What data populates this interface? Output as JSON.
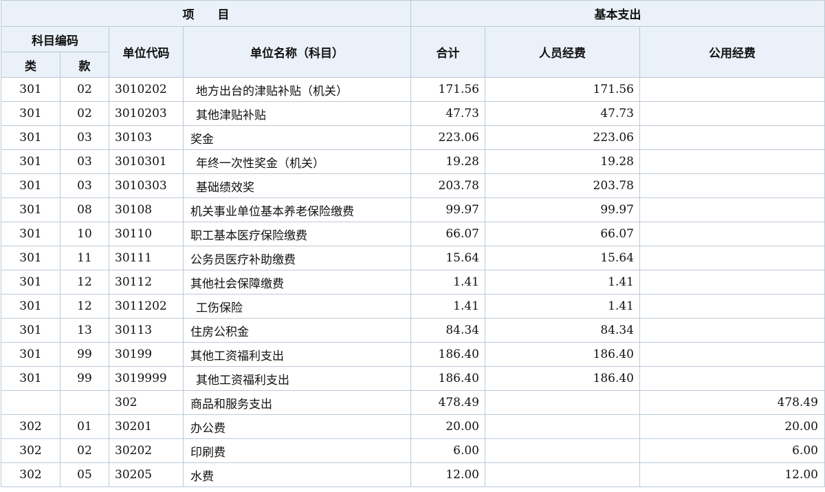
{
  "header": {
    "project": "项　　目",
    "basic_expenditure": "基本支出",
    "subject_code": "科目编码",
    "unit_code": "单位代码",
    "unit_name": "单位名称（科目）",
    "total": "合计",
    "personnel": "人员经费",
    "public": "公用经费",
    "class": "类",
    "section": "款"
  },
  "rows": [
    {
      "cls": "301",
      "kuan": "02",
      "code": "3010202",
      "name": "地方出台的津贴补贴（机关）",
      "indent": true,
      "total": "171.56",
      "personnel": "171.56",
      "public": ""
    },
    {
      "cls": "301",
      "kuan": "02",
      "code": "3010203",
      "name": "其他津贴补贴",
      "indent": true,
      "total": "47.73",
      "personnel": "47.73",
      "public": ""
    },
    {
      "cls": "301",
      "kuan": "03",
      "code": "30103",
      "name": "奖金",
      "indent": false,
      "total": "223.06",
      "personnel": "223.06",
      "public": ""
    },
    {
      "cls": "301",
      "kuan": "03",
      "code": "3010301",
      "name": "年终一次性奖金（机关）",
      "indent": true,
      "total": "19.28",
      "personnel": "19.28",
      "public": ""
    },
    {
      "cls": "301",
      "kuan": "03",
      "code": "3010303",
      "name": "基础绩效奖",
      "indent": true,
      "total": "203.78",
      "personnel": "203.78",
      "public": ""
    },
    {
      "cls": "301",
      "kuan": "08",
      "code": "30108",
      "name": "机关事业单位基本养老保险缴费",
      "indent": false,
      "total": "99.97",
      "personnel": "99.97",
      "public": ""
    },
    {
      "cls": "301",
      "kuan": "10",
      "code": "30110",
      "name": "职工基本医疗保险缴费",
      "indent": false,
      "total": "66.07",
      "personnel": "66.07",
      "public": ""
    },
    {
      "cls": "301",
      "kuan": "11",
      "code": "30111",
      "name": "公务员医疗补助缴费",
      "indent": false,
      "total": "15.64",
      "personnel": "15.64",
      "public": ""
    },
    {
      "cls": "301",
      "kuan": "12",
      "code": "30112",
      "name": "其他社会保障缴费",
      "indent": false,
      "total": "1.41",
      "personnel": "1.41",
      "public": ""
    },
    {
      "cls": "301",
      "kuan": "12",
      "code": "3011202",
      "name": "工伤保险",
      "indent": true,
      "total": "1.41",
      "personnel": "1.41",
      "public": ""
    },
    {
      "cls": "301",
      "kuan": "13",
      "code": "30113",
      "name": "住房公积金",
      "indent": false,
      "total": "84.34",
      "personnel": "84.34",
      "public": ""
    },
    {
      "cls": "301",
      "kuan": "99",
      "code": "30199",
      "name": "其他工资福利支出",
      "indent": false,
      "total": "186.40",
      "personnel": "186.40",
      "public": ""
    },
    {
      "cls": "301",
      "kuan": "99",
      "code": "3019999",
      "name": "其他工资福利支出",
      "indent": true,
      "total": "186.40",
      "personnel": "186.40",
      "public": ""
    },
    {
      "cls": "",
      "kuan": "",
      "code": "302",
      "name": "商品和服务支出",
      "indent": false,
      "total": "478.49",
      "personnel": "",
      "public": "478.49"
    },
    {
      "cls": "302",
      "kuan": "01",
      "code": "30201",
      "name": "办公费",
      "indent": false,
      "total": "20.00",
      "personnel": "",
      "public": "20.00"
    },
    {
      "cls": "302",
      "kuan": "02",
      "code": "30202",
      "name": "印刷费",
      "indent": false,
      "total": "6.00",
      "personnel": "",
      "public": "6.00"
    },
    {
      "cls": "302",
      "kuan": "05",
      "code": "30205",
      "name": "水费",
      "indent": false,
      "total": "12.00",
      "personnel": "",
      "public": "12.00"
    }
  ]
}
